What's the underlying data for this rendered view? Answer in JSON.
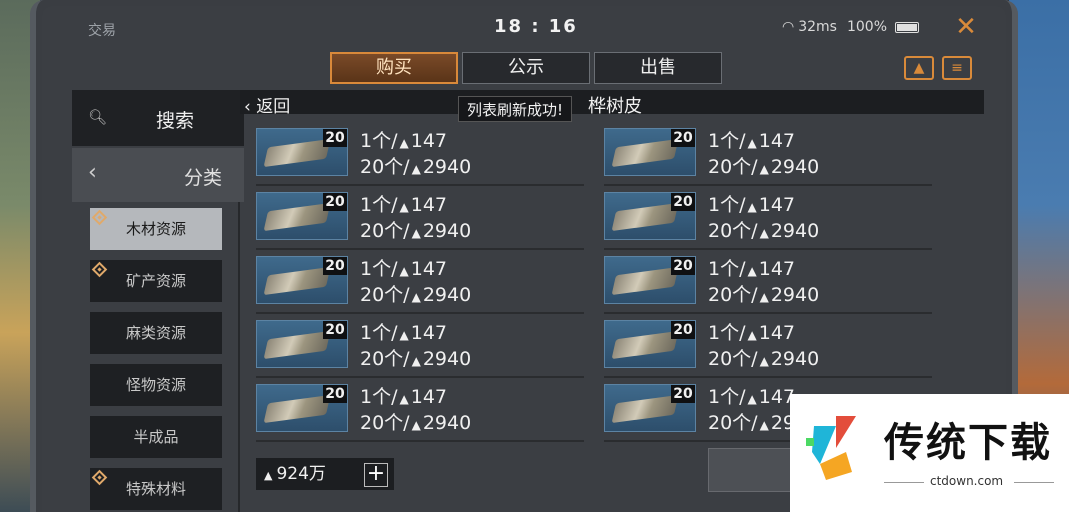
{
  "status": {
    "title": "交易",
    "time": "18 : 16",
    "network": "32ms",
    "battery": "100%"
  },
  "tabs": [
    {
      "label": "购买",
      "active": true
    },
    {
      "label": "公示",
      "active": false
    },
    {
      "label": "出售",
      "active": false
    }
  ],
  "sidebar": {
    "search_label": "搜索",
    "category_label": "分类",
    "categories": [
      {
        "label": "木材资源",
        "active": true,
        "badge": true
      },
      {
        "label": "矿产资源",
        "active": false,
        "badge": true
      },
      {
        "label": "麻类资源",
        "active": false,
        "badge": false
      },
      {
        "label": "怪物资源",
        "active": false,
        "badge": false
      },
      {
        "label": "半成品",
        "active": false,
        "badge": false
      },
      {
        "label": "特殊材料",
        "active": false,
        "badge": true
      }
    ]
  },
  "main": {
    "back_label": "返回",
    "item_title": "桦树皮",
    "toast": "列表刷新成功!",
    "listings": [
      {
        "qty": "20",
        "unit_label": "1个/",
        "unit_price": "147",
        "total_label": "20个/",
        "total_price": "2940"
      },
      {
        "qty": "20",
        "unit_label": "1个/",
        "unit_price": "147",
        "total_label": "20个/",
        "total_price": "2940"
      },
      {
        "qty": "20",
        "unit_label": "1个/",
        "unit_price": "147",
        "total_label": "20个/",
        "total_price": "2940"
      },
      {
        "qty": "20",
        "unit_label": "1个/",
        "unit_price": "147",
        "total_label": "20个/",
        "total_price": "2940"
      },
      {
        "qty": "20",
        "unit_label": "1个/",
        "unit_price": "147",
        "total_label": "20个/",
        "total_price": "2940"
      },
      {
        "qty": "20",
        "unit_label": "1个/",
        "unit_price": "147",
        "total_label": "20个/",
        "total_price": "2940"
      },
      {
        "qty": "20",
        "unit_label": "1个/",
        "unit_price": "147",
        "total_label": "20个/",
        "total_price": "2940"
      },
      {
        "qty": "20",
        "unit_label": "1个/",
        "unit_price": "147",
        "total_label": "20个/",
        "total_price": "2940"
      },
      {
        "qty": "20",
        "unit_label": "1个/",
        "unit_price": "147",
        "total_label": "20个/",
        "total_price": "2940"
      },
      {
        "qty": "20",
        "unit_label": "1个/",
        "unit_price": "147",
        "total_label": "20个/",
        "total_price": "2940"
      }
    ],
    "wallet": "924万"
  },
  "watermark": {
    "text": "传统下载",
    "url": "ctdown.com"
  },
  "colors": {
    "accent": "#d98a3a",
    "panel": "#1e2023",
    "thumb": "#2d4e6b"
  },
  "icons": {
    "coin": "coin-icon",
    "search": "search-icon",
    "close": "close-icon"
  }
}
